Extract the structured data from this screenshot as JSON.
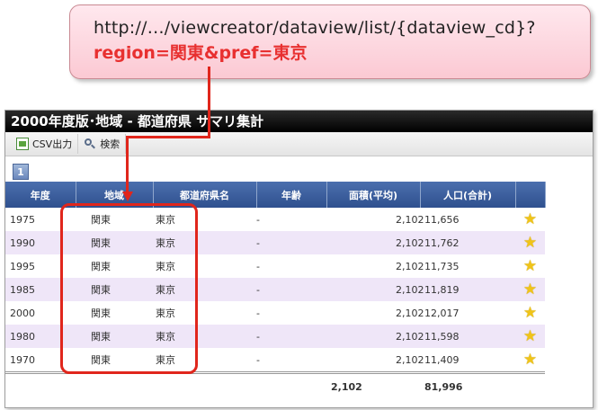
{
  "callout": {
    "url": "http://…/viewcreator/dataview/list/{dataview_cd}?",
    "params": "region=関東&pref=東京"
  },
  "window": {
    "title": "2000年度版･地域 - 都道府県 サマリ集計"
  },
  "toolbar": {
    "csv_label": "CSV出力",
    "search_label": "検索"
  },
  "pager": {
    "current": "1"
  },
  "table": {
    "headers": [
      "年度",
      "地域",
      "都道府県名",
      "年齢",
      "面積(平均)",
      "人口(合計)",
      ""
    ],
    "rows": [
      [
        "1975",
        "関東",
        "東京",
        "-",
        "2,102",
        "11,656"
      ],
      [
        "1990",
        "関東",
        "東京",
        "-",
        "2,102",
        "11,762"
      ],
      [
        "1995",
        "関東",
        "東京",
        "-",
        "2,102",
        "11,735"
      ],
      [
        "1985",
        "関東",
        "東京",
        "-",
        "2,102",
        "11,819"
      ],
      [
        "2000",
        "関東",
        "東京",
        "-",
        "2,102",
        "12,017"
      ],
      [
        "1980",
        "関東",
        "東京",
        "-",
        "2,102",
        "11,598"
      ],
      [
        "1970",
        "関東",
        "東京",
        "-",
        "2,102",
        "11,409"
      ]
    ],
    "footer": {
      "area": "2,102",
      "population": "81,996"
    }
  },
  "colors": {
    "accent": "#e0261c",
    "header": "#2f508e",
    "row_alt": "#efe6f8"
  },
  "icons": {
    "favorite": "star-icon",
    "csv": "csv-icon",
    "search": "search-icon"
  }
}
